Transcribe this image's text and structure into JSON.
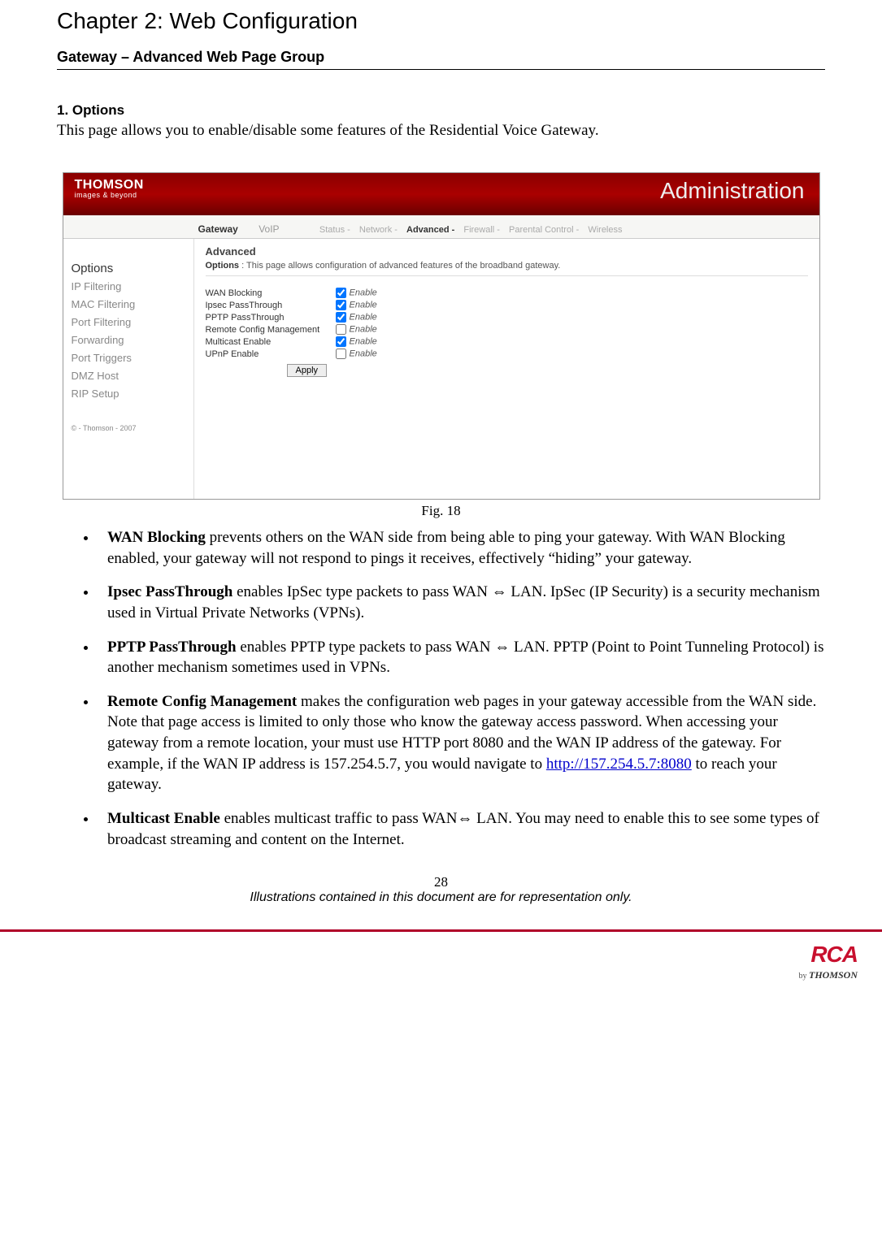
{
  "chapter_title": "Chapter 2: Web Configuration",
  "section_title": "Gateway – Advanced Web Page Group",
  "subheading": "1. Options",
  "intro_text": "This page allows you to enable/disable some features of the Residential Voice Gateway.",
  "fig_caption": "Fig. 18",
  "screenshot": {
    "brand": "THOMSON",
    "brand_sub": "images & beyond",
    "header_right": "Administration",
    "tabs": {
      "gateway": "Gateway",
      "voip": "VoIP"
    },
    "subtabs": {
      "status": "Status -",
      "network": "Network -",
      "advanced": "Advanced -",
      "firewall": "Firewall -",
      "parental": "Parental Control -",
      "wireless": "Wireless"
    },
    "sidebar": {
      "heading": "Options",
      "items": [
        "IP Filtering",
        "MAC Filtering",
        "Port Filtering",
        "Forwarding",
        "Port Triggers",
        "DMZ Host",
        "RIP Setup"
      ],
      "copyright": "© - Thomson - 2007"
    },
    "panel": {
      "title": "Advanced",
      "desc_label": "Options",
      "desc_text": "This page allows configuration of advanced features of the broadband gateway.",
      "rows": [
        {
          "label": "WAN Blocking",
          "checked": true
        },
        {
          "label": "Ipsec PassThrough",
          "checked": true
        },
        {
          "label": "PPTP PassThrough",
          "checked": true
        },
        {
          "label": "Remote Config Management",
          "checked": false
        },
        {
          "label": "Multicast Enable",
          "checked": true
        },
        {
          "label": "UPnP Enable",
          "checked": false
        }
      ],
      "enable_text": "Enable",
      "apply": "Apply"
    }
  },
  "bullets": [
    {
      "term": "WAN Blocking",
      "text": " prevents others on the WAN side from being able to ping your gateway. With WAN Blocking enabled, your gateway will not respond to pings it receives, effectively “hiding” your gateway."
    },
    {
      "term": "Ipsec PassThrough",
      "text": " enables IpSec type packets to pass WAN ⇔ LAN. IpSec (IP Security) is a security mechanism used in Virtual Private Networks (VPNs)."
    },
    {
      "term": "PPTP PassThrough",
      "text": " enables PPTP type packets to pass WAN ⇔ LAN. PPTP (Point to Point Tunneling Protocol) is another mechanism sometimes used in VPNs."
    },
    {
      "term": "Remote Config Management",
      "text": " makes the configuration web pages in your gateway accessible from the WAN side. Note that page access is limited to only those who know the gateway access password. When accessing your gateway from a remote location, your must use HTTP port 8080 and the WAN IP address of the gateway. For example, if the WAN IP address is 157.254.5.7, you would navigate to ",
      "link": "http://157.254.5.7:8080",
      "text_after": " to reach your gateway."
    },
    {
      "term": "Multicast Enable",
      "text": " enables multicast traffic to pass WAN⇔ LAN. You may need to enable this to see some types of broadcast streaming and content on the Internet."
    }
  ],
  "page_number": "28",
  "disclaimer": "Illustrations contained in this document are for representation only.",
  "footer": {
    "rca": "RCA",
    "by": "by ",
    "thomson": "THOMSON"
  }
}
